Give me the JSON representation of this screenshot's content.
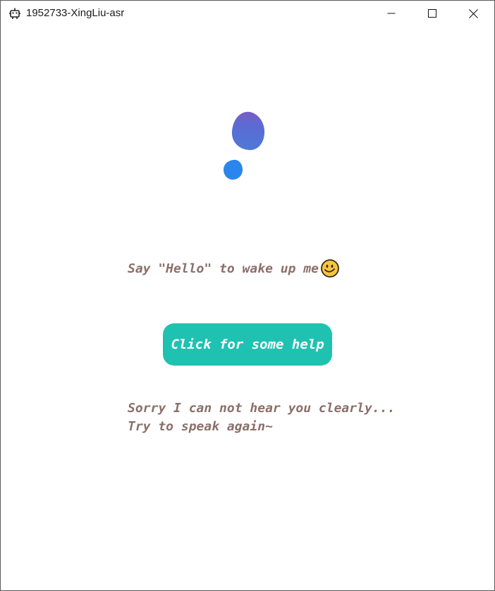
{
  "window": {
    "title": "1952733-XingLiu-asr",
    "controls": {
      "minimize_icon": "minimize-icon",
      "maximize_icon": "maximize-icon",
      "close_icon": "close-icon"
    }
  },
  "assistant": {
    "orb_colors": [
      "#7a5cc4",
      "#4f78d8",
      "#2a86ec"
    ],
    "wake_prompt": "Say \"Hello\" to wake up me",
    "wake_emoji": "smiley-emoji-icon",
    "help_button_label": "Click for some help",
    "accent_color": "#1fc2b1",
    "text_color": "#8b6f6a",
    "status_line_1": "Sorry I can not hear you clearly...",
    "status_line_2": "Try to speak again~"
  }
}
